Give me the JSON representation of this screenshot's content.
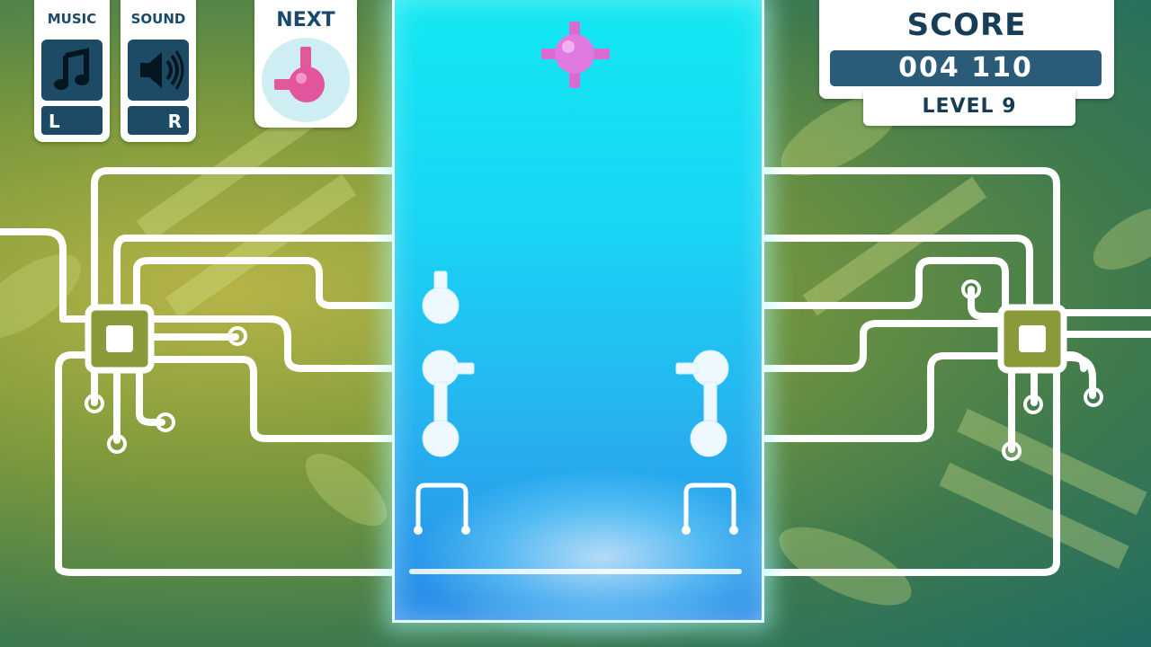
{
  "hud": {
    "music": {
      "label": "MUSIC",
      "key": "L",
      "icon": "music-note-icon"
    },
    "sound": {
      "label": "SOUND",
      "key": "R",
      "icon": "speaker-icon"
    },
    "next": {
      "label": "NEXT",
      "piece_icon": "pink-connector-piece-icon"
    },
    "score": {
      "label": "SCORE",
      "value": "004 110",
      "level": "LEVEL 9"
    }
  },
  "colors": {
    "panel_dark": "#1d4b66",
    "piece_pink": "#e05aa8",
    "well_cyan": "#12e8f2",
    "circuit_white": "#ffffff"
  }
}
